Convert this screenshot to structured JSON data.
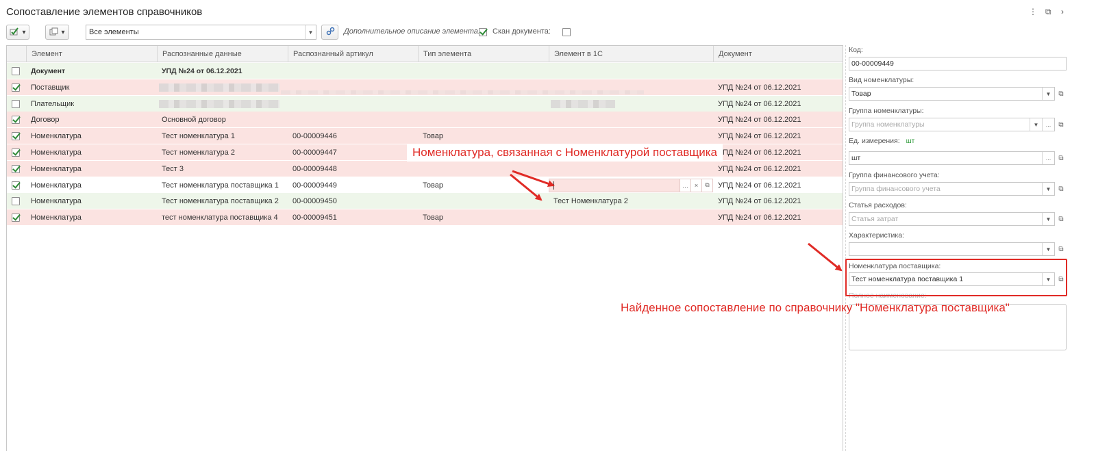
{
  "window": {
    "title": "Сопоставление элементов справочников",
    "controls": [
      "⋮",
      "⧉",
      "›"
    ]
  },
  "toolbar": {
    "filter_value": "Все элементы",
    "extra_description_label": "Дополнительное описание элемента:",
    "extra_description_checked": true,
    "scan_label": "Скан документа:",
    "scan_checked": false
  },
  "table": {
    "columns": [
      "Элемент",
      "Распознанные данные",
      "Распознанный артикул",
      "Тип элемента",
      "Элемент в 1С",
      "Документ"
    ],
    "rows": [
      {
        "checked": false,
        "color": "green",
        "bold": true,
        "element": "Документ",
        "recognized": "УПД №24 от 06.12.2021",
        "article": "",
        "type": "",
        "element1c": "",
        "document": ""
      },
      {
        "checked": true,
        "color": "red",
        "bold": false,
        "element": "Поставщик",
        "recognized": "",
        "article": "",
        "type": "",
        "element1c": "",
        "document": "УПД №24 от 06.12.2021"
      },
      {
        "checked": false,
        "color": "green",
        "bold": false,
        "element": "Плательщик",
        "recognized": "",
        "article": "",
        "type": "",
        "element1c": "",
        "document": "УПД №24 от 06.12.2021"
      },
      {
        "checked": true,
        "color": "red",
        "bold": false,
        "element": "Договор",
        "recognized": "Основной договор",
        "article": "",
        "type": "",
        "element1c": "",
        "document": "УПД №24 от 06.12.2021"
      },
      {
        "checked": true,
        "color": "red",
        "bold": false,
        "element": "Номенклатура",
        "recognized": "Тест номенклатура 1",
        "article": "00-00009446",
        "type": "Товар",
        "element1c": "",
        "document": "УПД №24 от 06.12.2021"
      },
      {
        "checked": true,
        "color": "red",
        "bold": false,
        "element": "Номенклатура",
        "recognized": "Тест номенклатура 2",
        "article": "00-00009447",
        "type": "",
        "element1c": "",
        "document": "УПД №24 от 06.12.2021"
      },
      {
        "checked": true,
        "color": "red",
        "bold": false,
        "element": "Номенклатура",
        "recognized": "Тест 3",
        "article": "00-00009448",
        "type": "",
        "element1c": "",
        "document": "УПД №24 от 06.12.2021"
      },
      {
        "checked": true,
        "color": "white",
        "bold": false,
        "element": "Номенклатура",
        "recognized": "Тест номенклатура поставщика 1",
        "article": "00-00009449",
        "type": "Товар",
        "element1c": "",
        "document": "УПД №24 от 06.12.2021"
      },
      {
        "checked": false,
        "color": "green",
        "bold": false,
        "element": "Номенклатура",
        "recognized": "Тест номенклатура поставщика 2",
        "article": "00-00009450",
        "type": "",
        "element1c": "Тест Номенклатура 2",
        "document": "УПД №24 от 06.12.2021"
      },
      {
        "checked": true,
        "color": "red",
        "bold": false,
        "element": "Номенклатура",
        "recognized": "тест номенклатура поставщика 4",
        "article": "00-00009451",
        "type": "Товар",
        "element1c": "",
        "document": "УПД №24 от 06.12.2021"
      }
    ]
  },
  "panel": {
    "code_label": "Код:",
    "code_value": "00-00009449",
    "kind_label": "Вид номенклатуры:",
    "kind_value": "Товар",
    "group_label": "Группа номенклатуры:",
    "group_placeholder": "Группа номенклатуры",
    "unit_label": "Ед. измерения:",
    "unit_hint": "шт",
    "unit_value": "шт",
    "fin_group_label": "Группа финансового учета:",
    "fin_group_placeholder": "Группа финансового учета",
    "expense_label": "Статья расходов:",
    "expense_placeholder": "Статья затрат",
    "characteristic_label": "Характеристика:",
    "characteristic_value": "",
    "supplier_item_label": "Номенклатура поставщика:",
    "supplier_item_value": "Тест номенклатура поставщика 1",
    "full_name_label": "Полное наименование:"
  },
  "annotations": {
    "linked_callout": "Номенклатура, связанная с Номенклатурой поставщика",
    "found_callout": "Найденное сопоставление по справочнику \"Номенклатура поставщика\"",
    "color": "#e02b26"
  }
}
